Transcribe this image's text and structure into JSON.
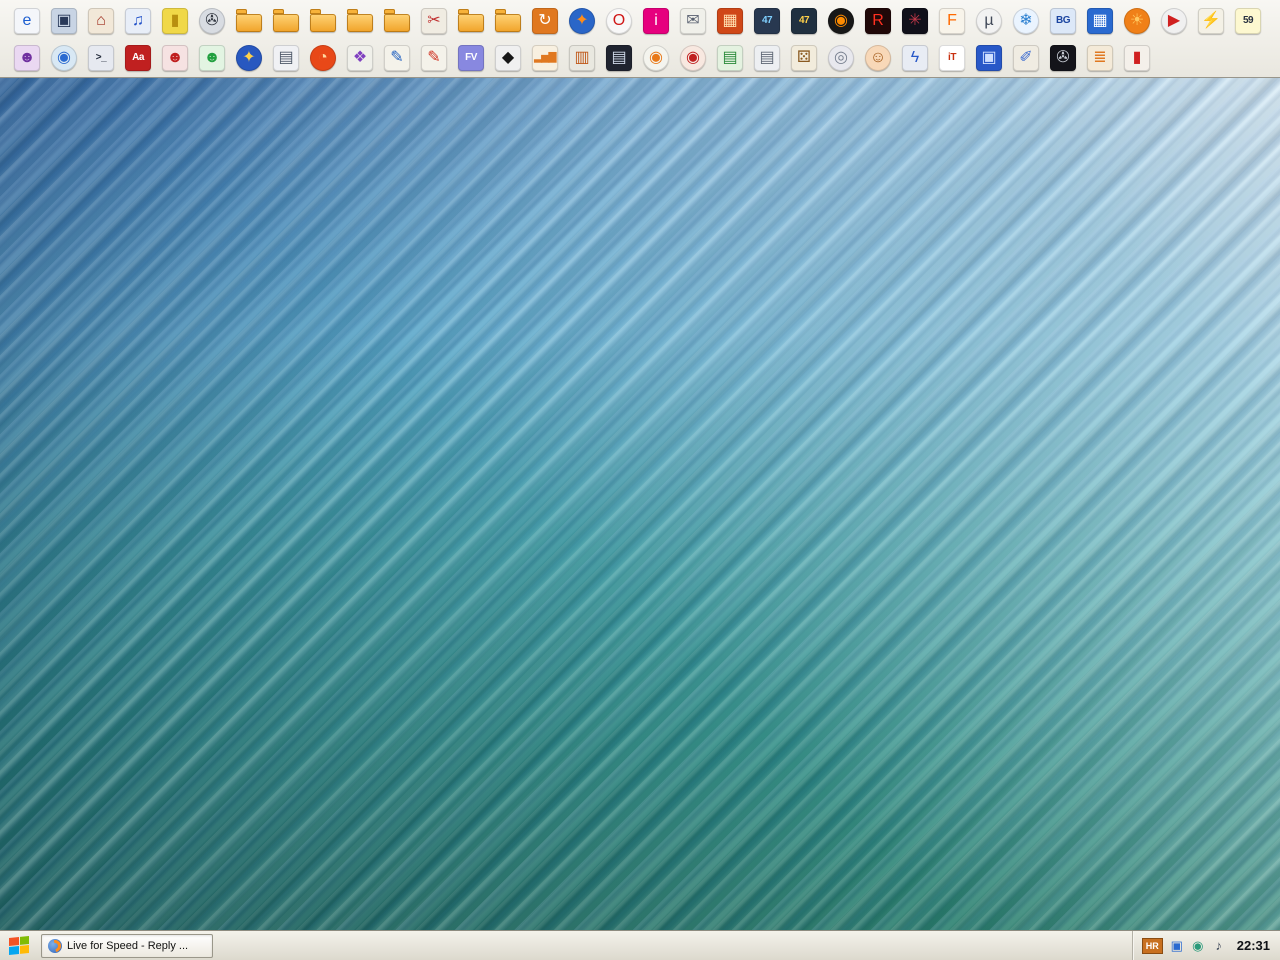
{
  "wallpaper": {
    "palette": {
      "top_blue": "#4f8fc4",
      "light_cyan": "#cdeef8",
      "mid_teal": "#3f9da4",
      "bottom_green": "#2a7f6e",
      "streak_navy": "#0c225a"
    }
  },
  "quicklaunch": {
    "row1": [
      {
        "name": "internet-explorer-icon",
        "glyph": "e",
        "fg": "#1c5ed0",
        "bg": "#f4f6fa",
        "shape": "square"
      },
      {
        "name": "display-icon",
        "glyph": "▣",
        "fg": "#2a3a5a",
        "bg": "#c8d4e4",
        "shape": "square"
      },
      {
        "name": "home-icon",
        "glyph": "⌂",
        "fg": "#a03020",
        "bg": "#f2e8d8",
        "shape": "square"
      },
      {
        "name": "music-note-icon",
        "glyph": "♫",
        "fg": "#2050c8",
        "bg": "#e8eef8",
        "shape": "square"
      },
      {
        "name": "yellow-can-icon",
        "glyph": "▮",
        "fg": "#b89010",
        "bg": "#f0d848",
        "shape": "square"
      },
      {
        "name": "film-reel-icon",
        "glyph": "✇",
        "fg": "#333842",
        "bg": "#d8dce2",
        "shape": "circle"
      },
      {
        "name": "folder-icon",
        "shape": "folder"
      },
      {
        "name": "folder-icon",
        "shape": "folder"
      },
      {
        "name": "folder-icon",
        "shape": "folder"
      },
      {
        "name": "folder-icon",
        "shape": "folder"
      },
      {
        "name": "folder-icon",
        "shape": "folder"
      },
      {
        "name": "cut-tools-icon",
        "glyph": "✂",
        "fg": "#c03030",
        "bg": "#f0ece2",
        "shape": "square"
      },
      {
        "name": "folder-icon",
        "shape": "folder"
      },
      {
        "name": "folder-icon",
        "shape": "folder"
      },
      {
        "name": "package-recycle-icon",
        "glyph": "↻",
        "fg": "#ffffff",
        "bg": "#e07820",
        "shape": "square"
      },
      {
        "name": "firefox-icon",
        "glyph": "✦",
        "fg": "#ff8c1a",
        "bg": "#2a66c8",
        "shape": "circle"
      },
      {
        "name": "opera-icon",
        "glyph": "O",
        "fg": "#d01818",
        "bg": "#f8f8f8",
        "shape": "circle"
      },
      {
        "name": "pink-i-icon",
        "glyph": "i",
        "fg": "#ffffff",
        "bg": "#e6007e",
        "shape": "square"
      },
      {
        "name": "mail-icon",
        "glyph": "✉",
        "fg": "#586070",
        "bg": "#f0f0ea",
        "shape": "square"
      },
      {
        "name": "grid-faces-icon",
        "glyph": "▦",
        "fg": "#ffe0b0",
        "bg": "#d04818",
        "shape": "square"
      },
      {
        "name": "lightning-47-icon",
        "glyph": "47",
        "fg": "#7fd0ff",
        "bg": "#283850",
        "shape": "square"
      },
      {
        "name": "lightning-47-alt-icon",
        "glyph": "47",
        "fg": "#ffd24a",
        "bg": "#203040",
        "shape": "square"
      },
      {
        "name": "vinyl-disc-icon",
        "glyph": "◉",
        "fg": "#ff8c00",
        "bg": "#181818",
        "shape": "circle"
      },
      {
        "name": "red-r-icon",
        "glyph": "R",
        "fg": "#ff3020",
        "bg": "#200808",
        "shape": "square"
      },
      {
        "name": "dark-burst-icon",
        "glyph": "✳",
        "fg": "#c03848",
        "bg": "#10101a",
        "shape": "square"
      },
      {
        "name": "flame-f-icon",
        "glyph": "F",
        "fg": "#ff6a00",
        "bg": "#f8f4ea",
        "shape": "square"
      },
      {
        "name": "utorrent-icon",
        "glyph": "µ",
        "fg": "#404858",
        "bg": "#f2f2f2",
        "shape": "circle"
      },
      {
        "name": "snowflake-icon",
        "glyph": "❄",
        "fg": "#2a7fd0",
        "bg": "#eaf4ff",
        "shape": "circle"
      },
      {
        "name": "bg-app-icon",
        "glyph": "BG",
        "fg": "#1a44a0",
        "bg": "#dce8f8",
        "shape": "square"
      },
      {
        "name": "blue-grid-icon",
        "glyph": "▦",
        "fg": "#ffffff",
        "bg": "#2a6ad0",
        "shape": "square"
      },
      {
        "name": "orange-ball-icon",
        "glyph": "☀",
        "fg": "#ffc860",
        "bg": "#f08018",
        "shape": "circle"
      },
      {
        "name": "media-player-icon",
        "glyph": "▶",
        "fg": "#d02020",
        "bg": "#f0f0f0",
        "shape": "circle"
      },
      {
        "name": "double-lightning-icon",
        "glyph": "⚡",
        "fg": "#e8a000",
        "bg": "#f4f1e6",
        "shape": "square"
      },
      {
        "name": "volume-59-icon",
        "glyph": "59",
        "fg": "#283040",
        "bg": "#fdf8d0",
        "shape": "square"
      }
    ],
    "row2": [
      {
        "name": "purple-user-icon",
        "glyph": "☻",
        "fg": "#7030a0",
        "bg": "#ead8f2",
        "shape": "square"
      },
      {
        "name": "voice-globe-icon",
        "glyph": "◉",
        "fg": "#2a6ad0",
        "bg": "#d8e8f4",
        "shape": "circle"
      },
      {
        "name": "terminal-icon",
        "glyph": ">_",
        "fg": "#202838",
        "bg": "#e6e9f0",
        "shape": "square"
      },
      {
        "name": "red-book-icon",
        "glyph": "Aa",
        "fg": "#ffffff",
        "bg": "#c02020",
        "shape": "square"
      },
      {
        "name": "red-user-icon",
        "glyph": "☻",
        "fg": "#c02020",
        "bg": "#f6e2e2",
        "shape": "square"
      },
      {
        "name": "green-user-icon",
        "glyph": "☻",
        "fg": "#22a040",
        "bg": "#e2f4e2",
        "shape": "square"
      },
      {
        "name": "compass-icon",
        "glyph": "✦",
        "fg": "#ffd24a",
        "bg": "#2858c0",
        "shape": "circle"
      },
      {
        "name": "notes-window-icon",
        "glyph": "▤",
        "fg": "#505a6a",
        "bg": "#f0f1f4",
        "shape": "square"
      },
      {
        "name": "orange-orb-icon",
        "glyph": "◔",
        "fg": "#ffd8a0",
        "bg": "#e84818",
        "shape": "circle"
      },
      {
        "name": "color-cubes-icon",
        "glyph": "❖",
        "fg": "#8040c0",
        "bg": "#f0f0ea",
        "shape": "square"
      },
      {
        "name": "blue-quill-icon",
        "glyph": "✎",
        "fg": "#2060c0",
        "bg": "#f4f2ea",
        "shape": "square"
      },
      {
        "name": "red-quill-icon",
        "glyph": "✎",
        "fg": "#d03020",
        "bg": "#f4f2ea",
        "shape": "square"
      },
      {
        "name": "fv-app-icon",
        "glyph": "FV",
        "fg": "#ffffff",
        "bg": "#8888e0",
        "shape": "square"
      },
      {
        "name": "inkscape-icon",
        "glyph": "◆",
        "fg": "#181818",
        "bg": "#f0f0f0",
        "shape": "square"
      },
      {
        "name": "bar-chart-icon",
        "glyph": "▂▅▇",
        "fg": "#e07820",
        "bg": "#f8f0e0",
        "shape": "square"
      },
      {
        "name": "columns-window-icon",
        "glyph": "▥",
        "fg": "#c05818",
        "bg": "#e9e8e0",
        "shape": "square"
      },
      {
        "name": "filmstrip-icon",
        "glyph": "▤",
        "fg": "#cfd8e8",
        "bg": "#202430",
        "shape": "square"
      },
      {
        "name": "blender-icon",
        "glyph": "◉",
        "fg": "#e87818",
        "bg": "#f4f4ee",
        "shape": "circle"
      },
      {
        "name": "red-eye-icon",
        "glyph": "◉",
        "fg": "#c02020",
        "bg": "#f8e8e0",
        "shape": "circle"
      },
      {
        "name": "green-window-icon",
        "glyph": "▤",
        "fg": "#2a8a3a",
        "bg": "#e4f2e0",
        "shape": "square"
      },
      {
        "name": "gray-window-icon",
        "glyph": "▤",
        "fg": "#606876",
        "bg": "#edeff2",
        "shape": "square"
      },
      {
        "name": "dice-icon",
        "glyph": "⚄",
        "fg": "#8a5a20",
        "bg": "#f2ecdc",
        "shape": "square"
      },
      {
        "name": "dvd-icon",
        "glyph": "◎",
        "fg": "#788090",
        "bg": "#e8e8ee",
        "shape": "circle"
      },
      {
        "name": "face-icon",
        "glyph": "☺",
        "fg": "#a05818",
        "bg": "#f8d8b8",
        "shape": "circle"
      },
      {
        "name": "s-lightning-icon",
        "glyph": "ϟ",
        "fg": "#2858c8",
        "bg": "#e8ecf4",
        "shape": "square"
      },
      {
        "name": "it-doc-icon",
        "glyph": "iT",
        "fg": "#c83010",
        "bg": "#ffffff",
        "shape": "square"
      },
      {
        "name": "floppy-save-icon",
        "glyph": "▣",
        "fg": "#cfe0ff",
        "bg": "#2858c8",
        "shape": "square"
      },
      {
        "name": "pen-utility-icon",
        "glyph": "✐",
        "fg": "#3a6ad0",
        "bg": "#f0ece2",
        "shape": "square"
      },
      {
        "name": "black-fan-icon",
        "glyph": "✇",
        "fg": "#c8ccd4",
        "bg": "#14141a",
        "shape": "square"
      },
      {
        "name": "orange-stack-icon",
        "glyph": "≣",
        "fg": "#e07820",
        "bg": "#f4ead8",
        "shape": "square"
      },
      {
        "name": "thermometer-icon",
        "glyph": "▮",
        "fg": "#d02020",
        "bg": "#f4f0ea",
        "shape": "square"
      }
    ]
  },
  "taskbar": {
    "window_button": {
      "label": "Live for Speed - Reply ..."
    },
    "tray": {
      "language": "HR",
      "icons": [
        {
          "name": "network-monitors-icon",
          "glyph": "▣",
          "fg": "#2a6ad0"
        },
        {
          "name": "round-app-icon",
          "glyph": "◉",
          "fg": "#2a9a7a"
        },
        {
          "name": "volume-icon",
          "glyph": "♪",
          "fg": "#404a5a"
        }
      ],
      "clock": "22:31"
    }
  }
}
